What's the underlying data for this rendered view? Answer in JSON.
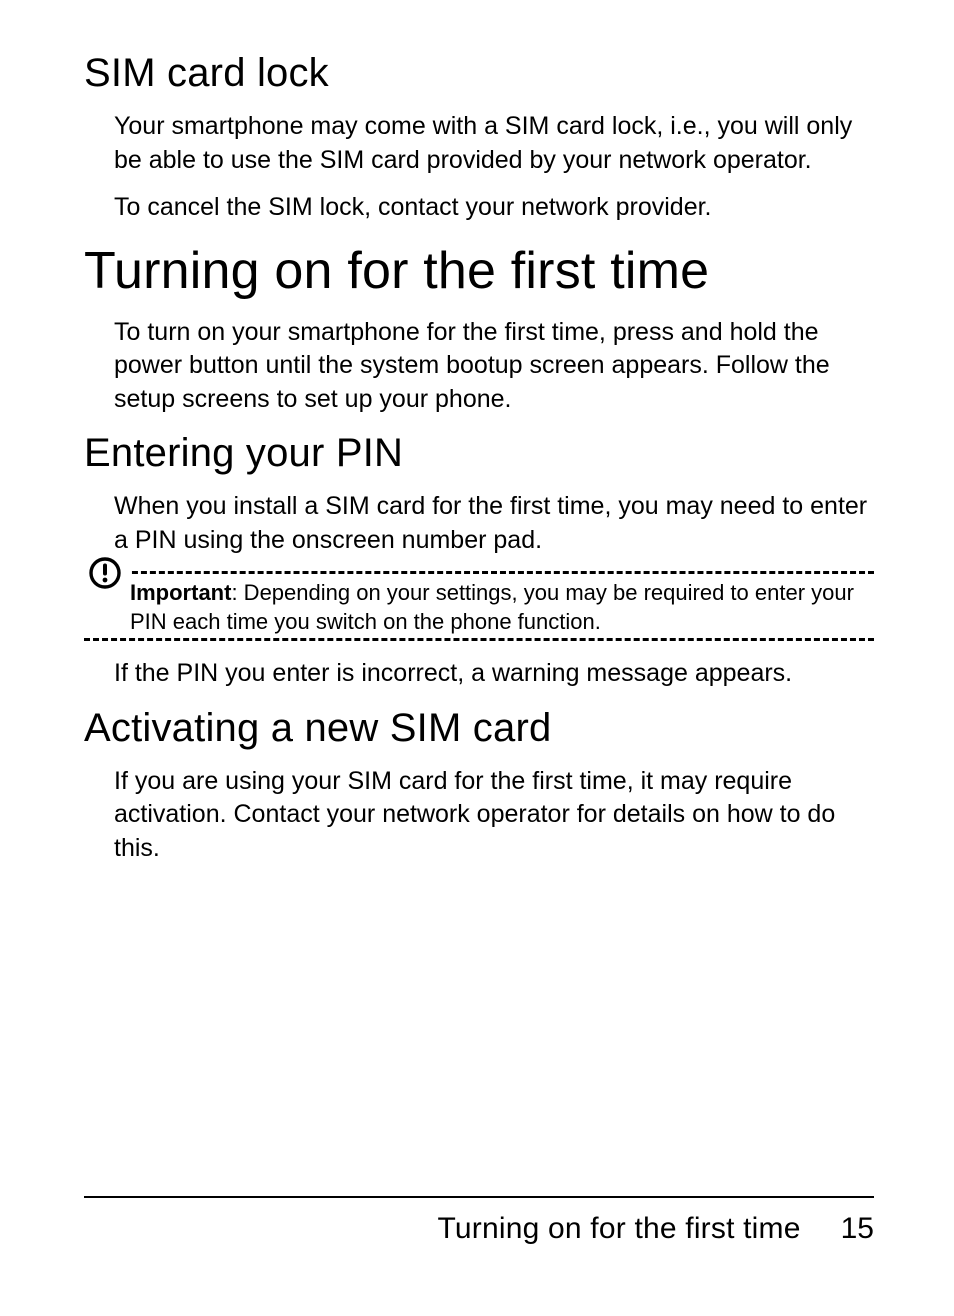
{
  "section_sim_lock": {
    "heading": "SIM card lock",
    "p1": "Your smartphone may come with a SIM card lock, i.e., you will only be able to use the SIM card provided by your network operator.",
    "p2": "To cancel the SIM lock, contact your network provider."
  },
  "section_turning_on": {
    "heading": "Turning on for the first time",
    "p1": "To turn on your smartphone for the first time, press and hold the power button until the system bootup screen appears. Follow the setup screens to set up your phone."
  },
  "section_pin": {
    "heading": "Entering your PIN",
    "p1": "When you install a SIM card for the first time, you may need to enter a PIN using the onscreen number pad.",
    "note_label": "Important",
    "note_text": ": Depending on your settings, you may be required to enter your PIN each time you switch on the phone function.",
    "p2": "If the PIN you enter is incorrect, a warning message appears."
  },
  "section_activate": {
    "heading": "Activating a new SIM card",
    "p1": "If you are using your SIM card for the first time, it may require activation. Contact your network operator for details on how to do this."
  },
  "footer": {
    "title": "Turning on for the first time",
    "page": "15"
  }
}
